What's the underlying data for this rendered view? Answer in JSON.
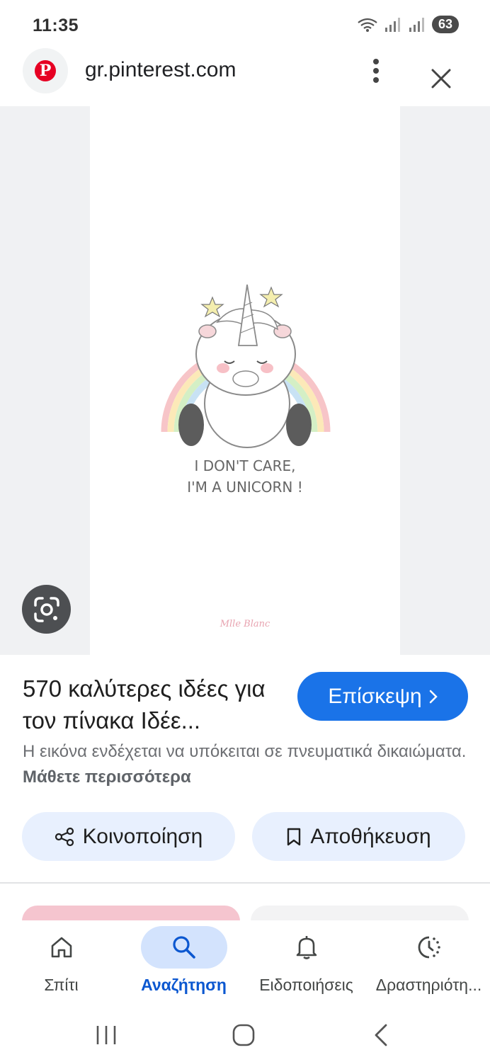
{
  "status_bar": {
    "time": "11:35",
    "battery": "63"
  },
  "url_bar": {
    "url": "gr.pinterest.com",
    "site_icon": "pinterest-logo",
    "logo_letter": "P"
  },
  "image": {
    "caption_line1": "I DON'T CARE,",
    "caption_line2": "I'M A UNICORN !",
    "signature": "Mlle Blanc"
  },
  "info": {
    "title": "570 καλύτερες ιδέες για τον πίνακα Ιδέε...",
    "visit_label": "Επίσκεψη",
    "copyright_text": "Η εικόνα ενδέχεται να υπόκειται σε πνευματικά δικαιώματα.",
    "learn_more": "Μάθετε περισσότερα",
    "share_label": "Κοινοποίηση",
    "save_label": "Αποθήκευση"
  },
  "bottom_nav": {
    "items": [
      {
        "label": "Σπίτι",
        "icon": "home-icon"
      },
      {
        "label": "Αναζήτηση",
        "icon": "search-icon"
      },
      {
        "label": "Ειδοποιήσεις",
        "icon": "bell-icon"
      },
      {
        "label": "Δραστηριότη...",
        "icon": "activity-icon"
      }
    ],
    "active_index": 1
  },
  "colors": {
    "accent": "#1a73e8",
    "pill_bg": "#e8f0fe",
    "active_nav": "#0b57d0",
    "pinterest": "#e60023"
  }
}
